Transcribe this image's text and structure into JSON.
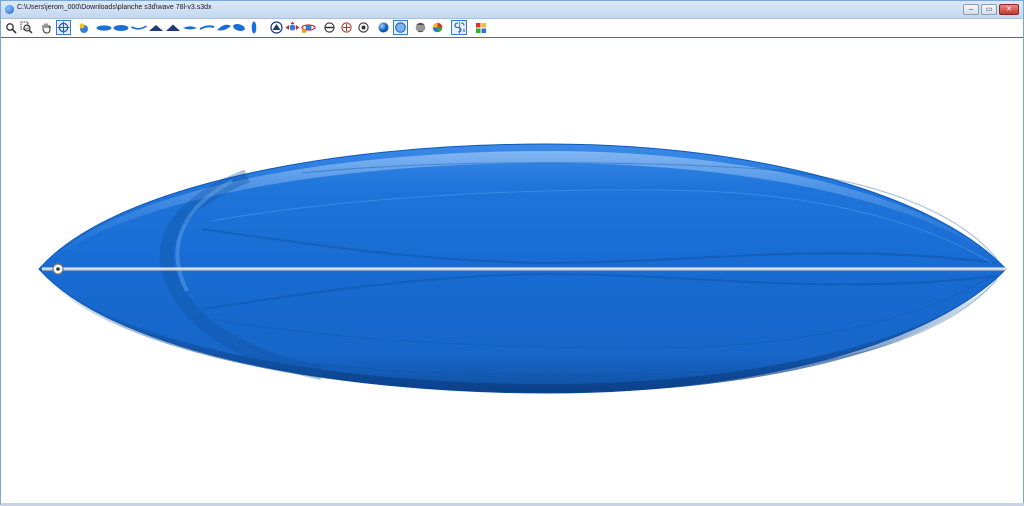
{
  "window": {
    "title": "C:\\Users\\jerom_000\\Downloads\\planche s3d\\wave 78l-v3.s3dx",
    "buttons": {
      "minimize": "–",
      "maximize": "▭",
      "close": "✕"
    }
  },
  "toolbar": {
    "tools": [
      {
        "name": "zoom-icon",
        "active": false
      },
      {
        "name": "zoom-window-icon",
        "active": false
      },
      {
        "name": "pan-hand-icon",
        "active": false
      },
      {
        "name": "rotate-move-icon",
        "active": true
      },
      {
        "name": "color-palette-icon",
        "active": false
      },
      {
        "name": "board-outline-view-icon",
        "active": false
      },
      {
        "name": "board-bottom-view-icon",
        "active": false
      },
      {
        "name": "board-rocker-view-icon",
        "active": false
      },
      {
        "name": "board-deck-view-icon",
        "active": false
      },
      {
        "name": "board-side-view-icon",
        "active": false
      },
      {
        "name": "board-slice-view-icon",
        "active": false
      },
      {
        "name": "board-thickness-view-icon",
        "active": false
      },
      {
        "name": "board-3d-view-icon",
        "active": false
      },
      {
        "name": "board-tail-view-icon",
        "active": false
      },
      {
        "name": "board-nose-view-icon",
        "active": false
      },
      {
        "name": "mirror-view-icon",
        "active": false
      },
      {
        "name": "red-arrows-icon",
        "active": false
      },
      {
        "name": "orbit-icon",
        "active": false
      },
      {
        "name": "shade-mode-icon",
        "active": false
      },
      {
        "name": "wireframe-mode-icon",
        "active": false
      },
      {
        "name": "control-points-icon",
        "active": false
      },
      {
        "name": "render-sphere-icon",
        "active": false
      },
      {
        "name": "transparency-icon",
        "active": true
      },
      {
        "name": "slices-icon",
        "active": false
      },
      {
        "name": "color-wheel-icon",
        "active": false
      },
      {
        "name": "symmetry-icon",
        "active": true
      },
      {
        "name": "color-grid-icon",
        "active": false
      }
    ]
  },
  "colors": {
    "board_main": "#1a6fd6",
    "board_dark": "#0f4fa8",
    "board_light": "#5aa3f0",
    "stringer": "#d8d8d8",
    "accent": "#3b78d0"
  }
}
